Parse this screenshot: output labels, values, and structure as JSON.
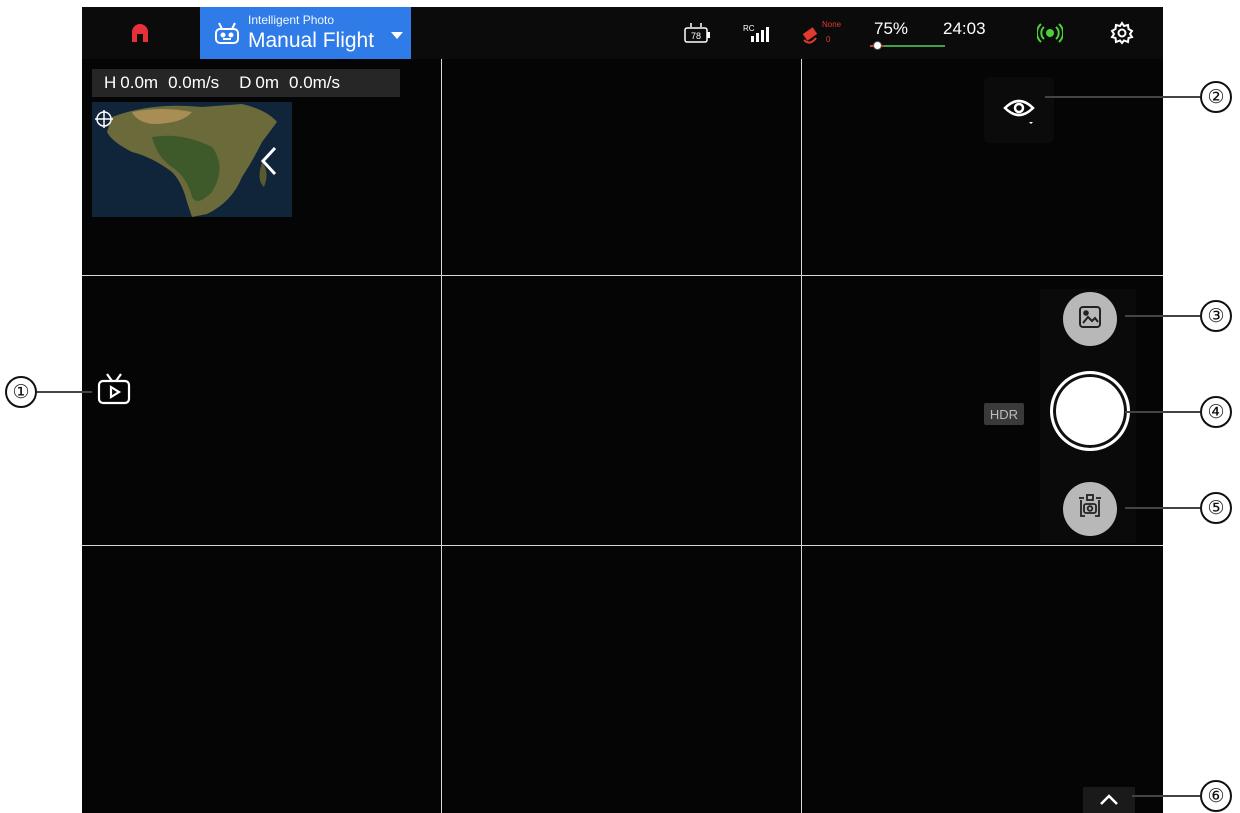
{
  "topbar": {
    "logo_icon": "brand-logo-icon",
    "mode": {
      "subtitle": "Intelligent Photo",
      "title": "Manual Flight",
      "icon": "drone-controller-icon"
    },
    "camera_battery": "78",
    "rc_label": "RC",
    "gps_status": "None",
    "gps_count": "0",
    "battery_percent": "75%",
    "flight_time": "24:03",
    "battery_level": 0.75,
    "colors": {
      "mode_bg": "#2f7be8",
      "logo": "#e8303a",
      "link": "#4cd137",
      "gps": "#e23b2e"
    }
  },
  "telemetry": {
    "height_label": "H",
    "height_value": "0.0m",
    "vertical_speed": "0.0m/s",
    "distance_label": "D",
    "distance_value": "0m",
    "horizontal_speed": "0.0m/s"
  },
  "controls": {
    "hdr_label": "HDR"
  },
  "callouts": [
    "①",
    "②",
    "③",
    "④",
    "⑤",
    "⑥"
  ]
}
